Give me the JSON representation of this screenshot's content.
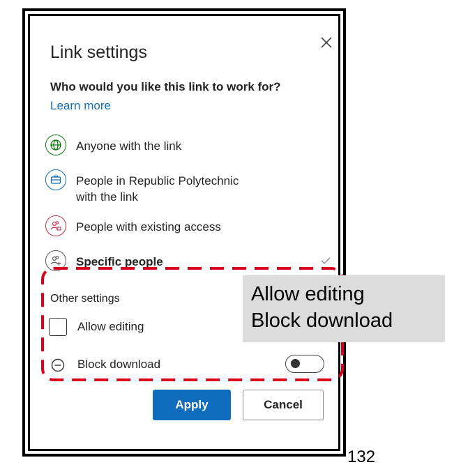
{
  "dialog": {
    "title": "Link settings",
    "question": "Who would you like this link to work for?",
    "learn_more": "Learn more",
    "options": [
      {
        "label": "Anyone with the link",
        "icon": "globe-icon",
        "color": "#107c10"
      },
      {
        "label_line1": "People in Republic Polytechnic",
        "label_line2": "with the link",
        "icon": "briefcase-icon",
        "color": "#0f6cbd"
      },
      {
        "label": "People with existing access",
        "icon": "people-lock-icon",
        "color": "#c4314b"
      },
      {
        "label": "Specific people",
        "icon": "people-add-icon",
        "color": "#555555",
        "selected": true
      }
    ],
    "other_settings": {
      "label": "Other settings",
      "allow_editing": {
        "label": "Allow editing",
        "checked": false
      },
      "block_download": {
        "label": "Block download",
        "enabled": false
      }
    },
    "buttons": {
      "apply": "Apply",
      "cancel": "Cancel"
    }
  },
  "callout": {
    "line1": "Allow editing",
    "line2": "Block download",
    "border_color": "#d9001b"
  },
  "page_number": "132",
  "colors": {
    "accent": "#0f6cbd"
  }
}
